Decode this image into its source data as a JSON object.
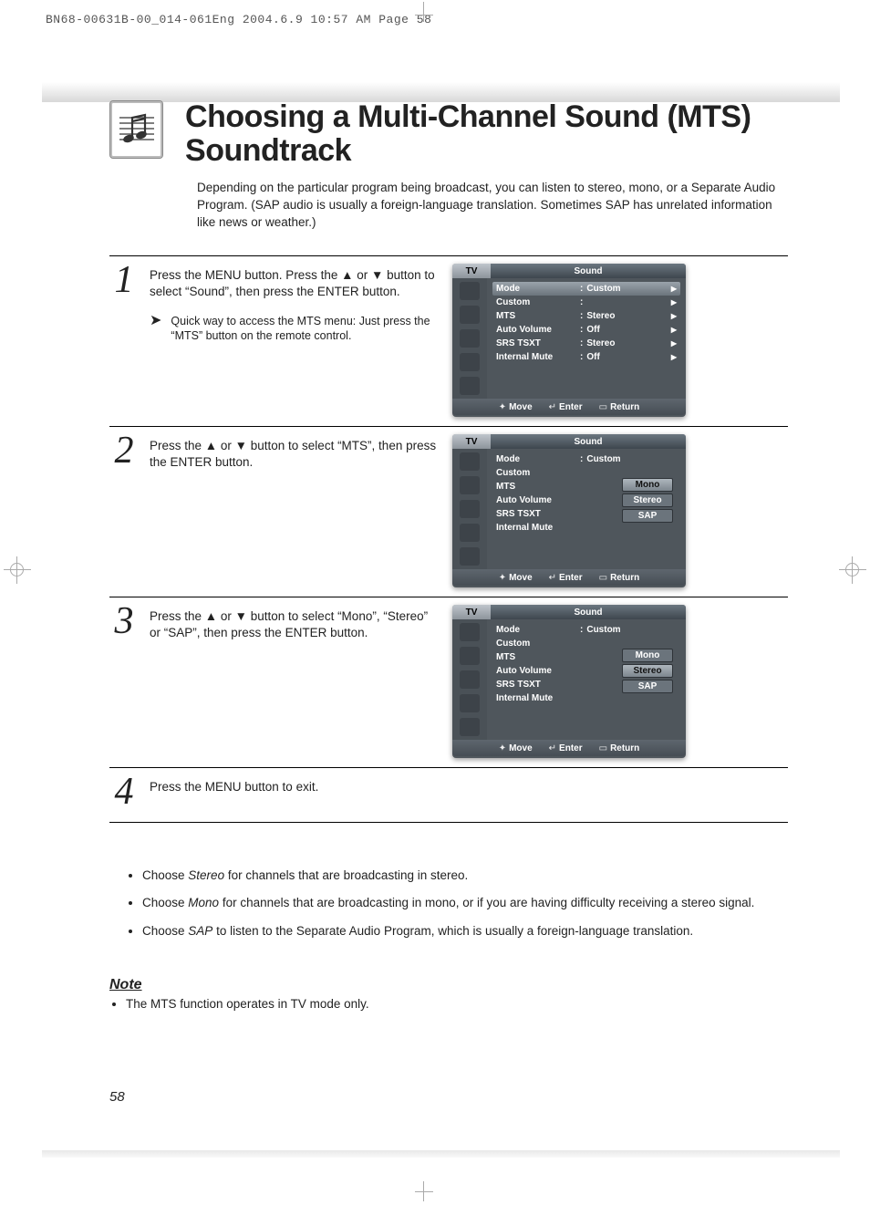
{
  "crop_header": "BN68-00631B-00_014-061Eng  2004.6.9  10:57 AM  Page 58",
  "title": "Choosing a Multi-Channel Sound (MTS) Soundtrack",
  "intro": "Depending on the particular program being broadcast, you can listen to stereo, mono, or a Separate Audio Program. (SAP audio is usually a foreign-language translation. Sometimes SAP has unrelated information like news or weather.)",
  "steps": [
    {
      "n": "1",
      "text": "Press the MENU button. Press the ▲ or ▼ button to select “Sound”, then press the ENTER button.",
      "tip": "Quick way to access the MTS menu: Just press the “MTS” button on the remote control.",
      "osd": "osd1"
    },
    {
      "n": "2",
      "text": "Press the ▲ or ▼ button to select “MTS”, then press the ENTER button.",
      "osd": "osd2"
    },
    {
      "n": "3",
      "text": "Press the ▲ or ▼ button to select “Mono”, “Stereo” or “SAP”, then press the ENTER button.",
      "osd": "osd3"
    },
    {
      "n": "4",
      "text": "Press the MENU button to exit."
    }
  ],
  "osd_common": {
    "tab": "TV",
    "title": "Sound",
    "foot": {
      "move": "Move",
      "enter": "Enter",
      "return": "Return"
    }
  },
  "osd1": {
    "selected": 0,
    "rows": [
      {
        "lbl": "Mode",
        "val": "Custom",
        "chev": true
      },
      {
        "lbl": "Custom",
        "val": "",
        "chev": true
      },
      {
        "lbl": "MTS",
        "val": "Stereo",
        "chev": true
      },
      {
        "lbl": "Auto Volume",
        "val": "Off",
        "chev": true
      },
      {
        "lbl": "SRS TSXT",
        "val": "Stereo",
        "chev": true
      },
      {
        "lbl": "Internal Mute",
        "val": "Off",
        "chev": true
      }
    ]
  },
  "osd2": {
    "selected": -1,
    "rows": [
      {
        "lbl": "Mode",
        "val": "Custom"
      },
      {
        "lbl": "Custom",
        "val": ""
      },
      {
        "lbl": "MTS",
        "val": ""
      },
      {
        "lbl": "Auto Volume",
        "val": ""
      },
      {
        "lbl": "SRS TSXT",
        "val": ""
      },
      {
        "lbl": "Internal Mute",
        "val": ""
      }
    ],
    "popup": {
      "options": [
        "Mono",
        "Stereo",
        "SAP"
      ],
      "sel": 0
    }
  },
  "osd3": {
    "selected": -1,
    "rows": [
      {
        "lbl": "Mode",
        "val": "Custom"
      },
      {
        "lbl": "Custom",
        "val": ""
      },
      {
        "lbl": "MTS",
        "val": ""
      },
      {
        "lbl": "Auto Volume",
        "val": ""
      },
      {
        "lbl": "SRS TSXT",
        "val": ""
      },
      {
        "lbl": "Internal Mute",
        "val": ""
      }
    ],
    "popup": {
      "options": [
        "Mono",
        "Stereo",
        "SAP"
      ],
      "sel": 1
    }
  },
  "bullets": [
    {
      "pre": "Choose ",
      "em": "Stereo",
      "post": " for channels that are broadcasting in stereo."
    },
    {
      "pre": "Choose ",
      "em": "Mono",
      "post": " for channels that are broadcasting in mono, or if you are having difficulty receiving a stereo signal."
    },
    {
      "pre": "Choose ",
      "em": "SAP",
      "post": " to listen to the Separate Audio Program, which is usually a foreign-language translation."
    }
  ],
  "note_label": "Note",
  "note_items": [
    "The MTS function operates in TV mode only."
  ],
  "page_number": "58"
}
